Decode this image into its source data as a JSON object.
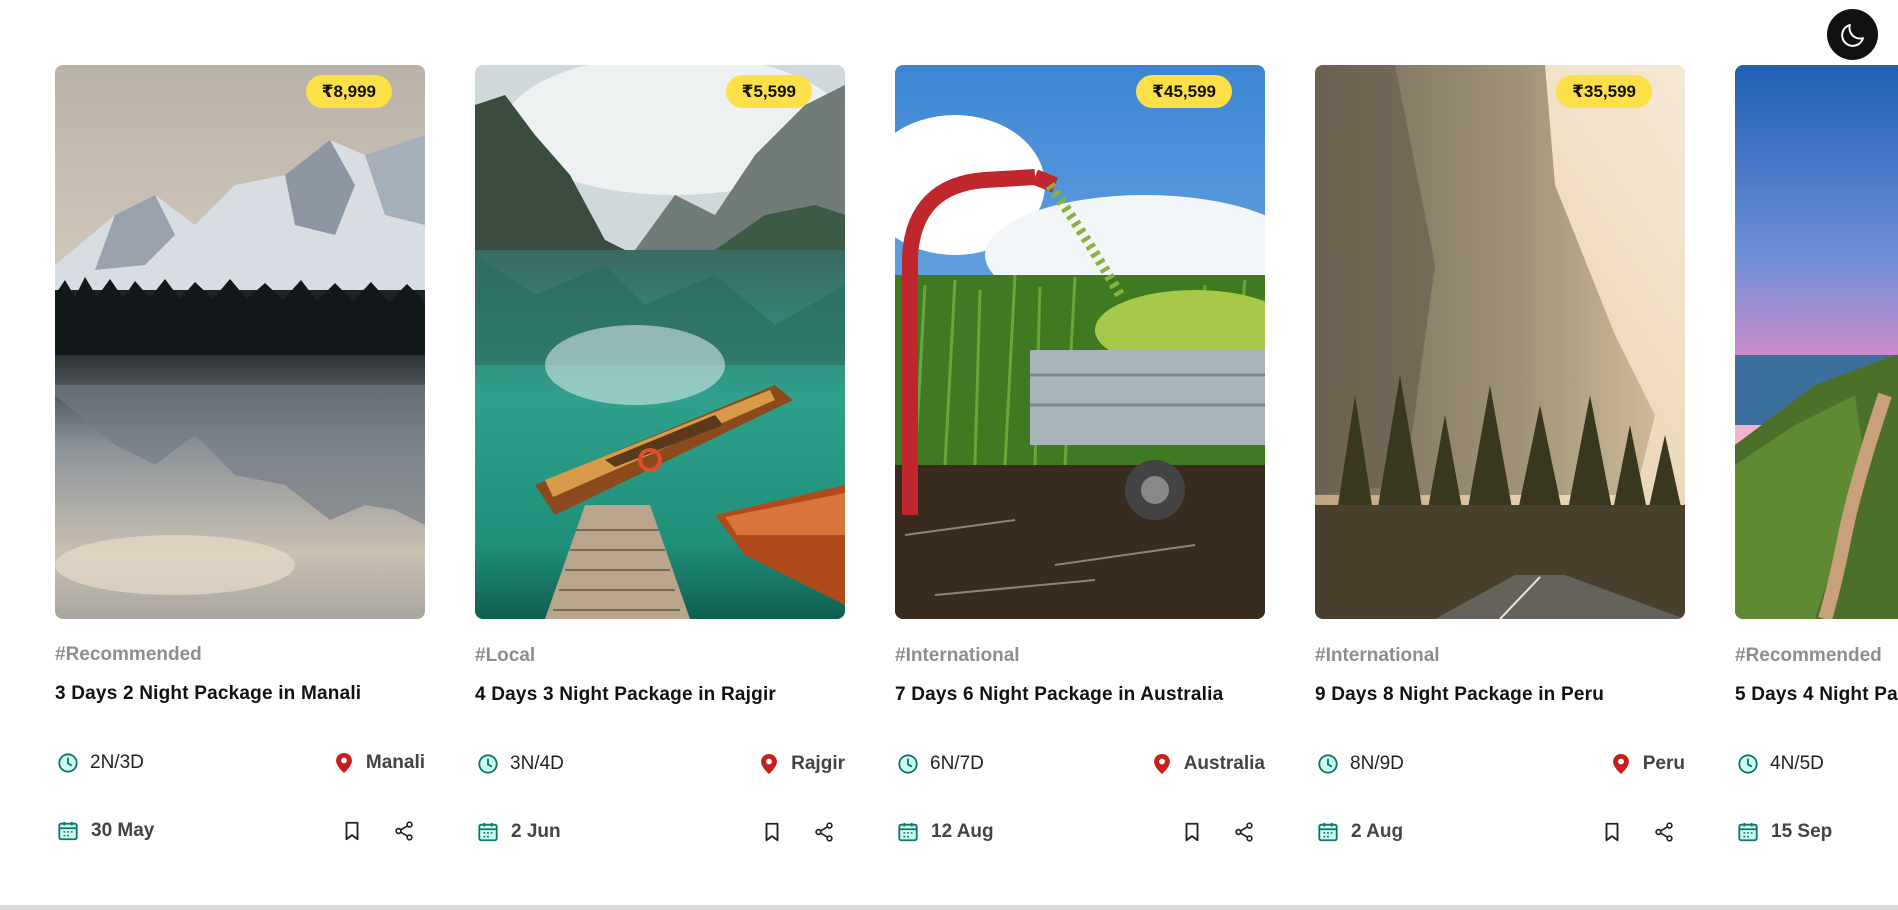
{
  "theme_toggle": {
    "icon": "moon-icon",
    "bg": "#111111"
  },
  "colors": {
    "price_badge": "#fde047",
    "accent_teal": "#14b8a6",
    "location_red": "#dc2626",
    "tag_gray": "#8d8d95"
  },
  "cards": [
    {
      "price": "₹8,999",
      "tag": "#Recommended",
      "title": "3 Days 2 Night Package in Manali",
      "duration": "2N/3D",
      "location": "Manali",
      "date": "30 May"
    },
    {
      "price": "₹5,599",
      "tag": "#Local",
      "title": "4 Days 3 Night Package in Rajgir",
      "duration": "3N/4D",
      "location": "Rajgir",
      "date": "2 Jun"
    },
    {
      "price": "₹45,599",
      "tag": "#International",
      "title": "7 Days 6 Night Package in Australia",
      "duration": "6N/7D",
      "location": "Australia",
      "date": "12 Aug"
    },
    {
      "price": "₹35,599",
      "tag": "#International",
      "title": "9 Days 8 Night Package in Peru",
      "duration": "8N/9D",
      "location": "Peru",
      "date": "2 Aug"
    },
    {
      "tag": "#Recommended",
      "title": "5 Days 4 Night Pa",
      "duration": "4N/5D",
      "date": "15 Sep"
    }
  ]
}
